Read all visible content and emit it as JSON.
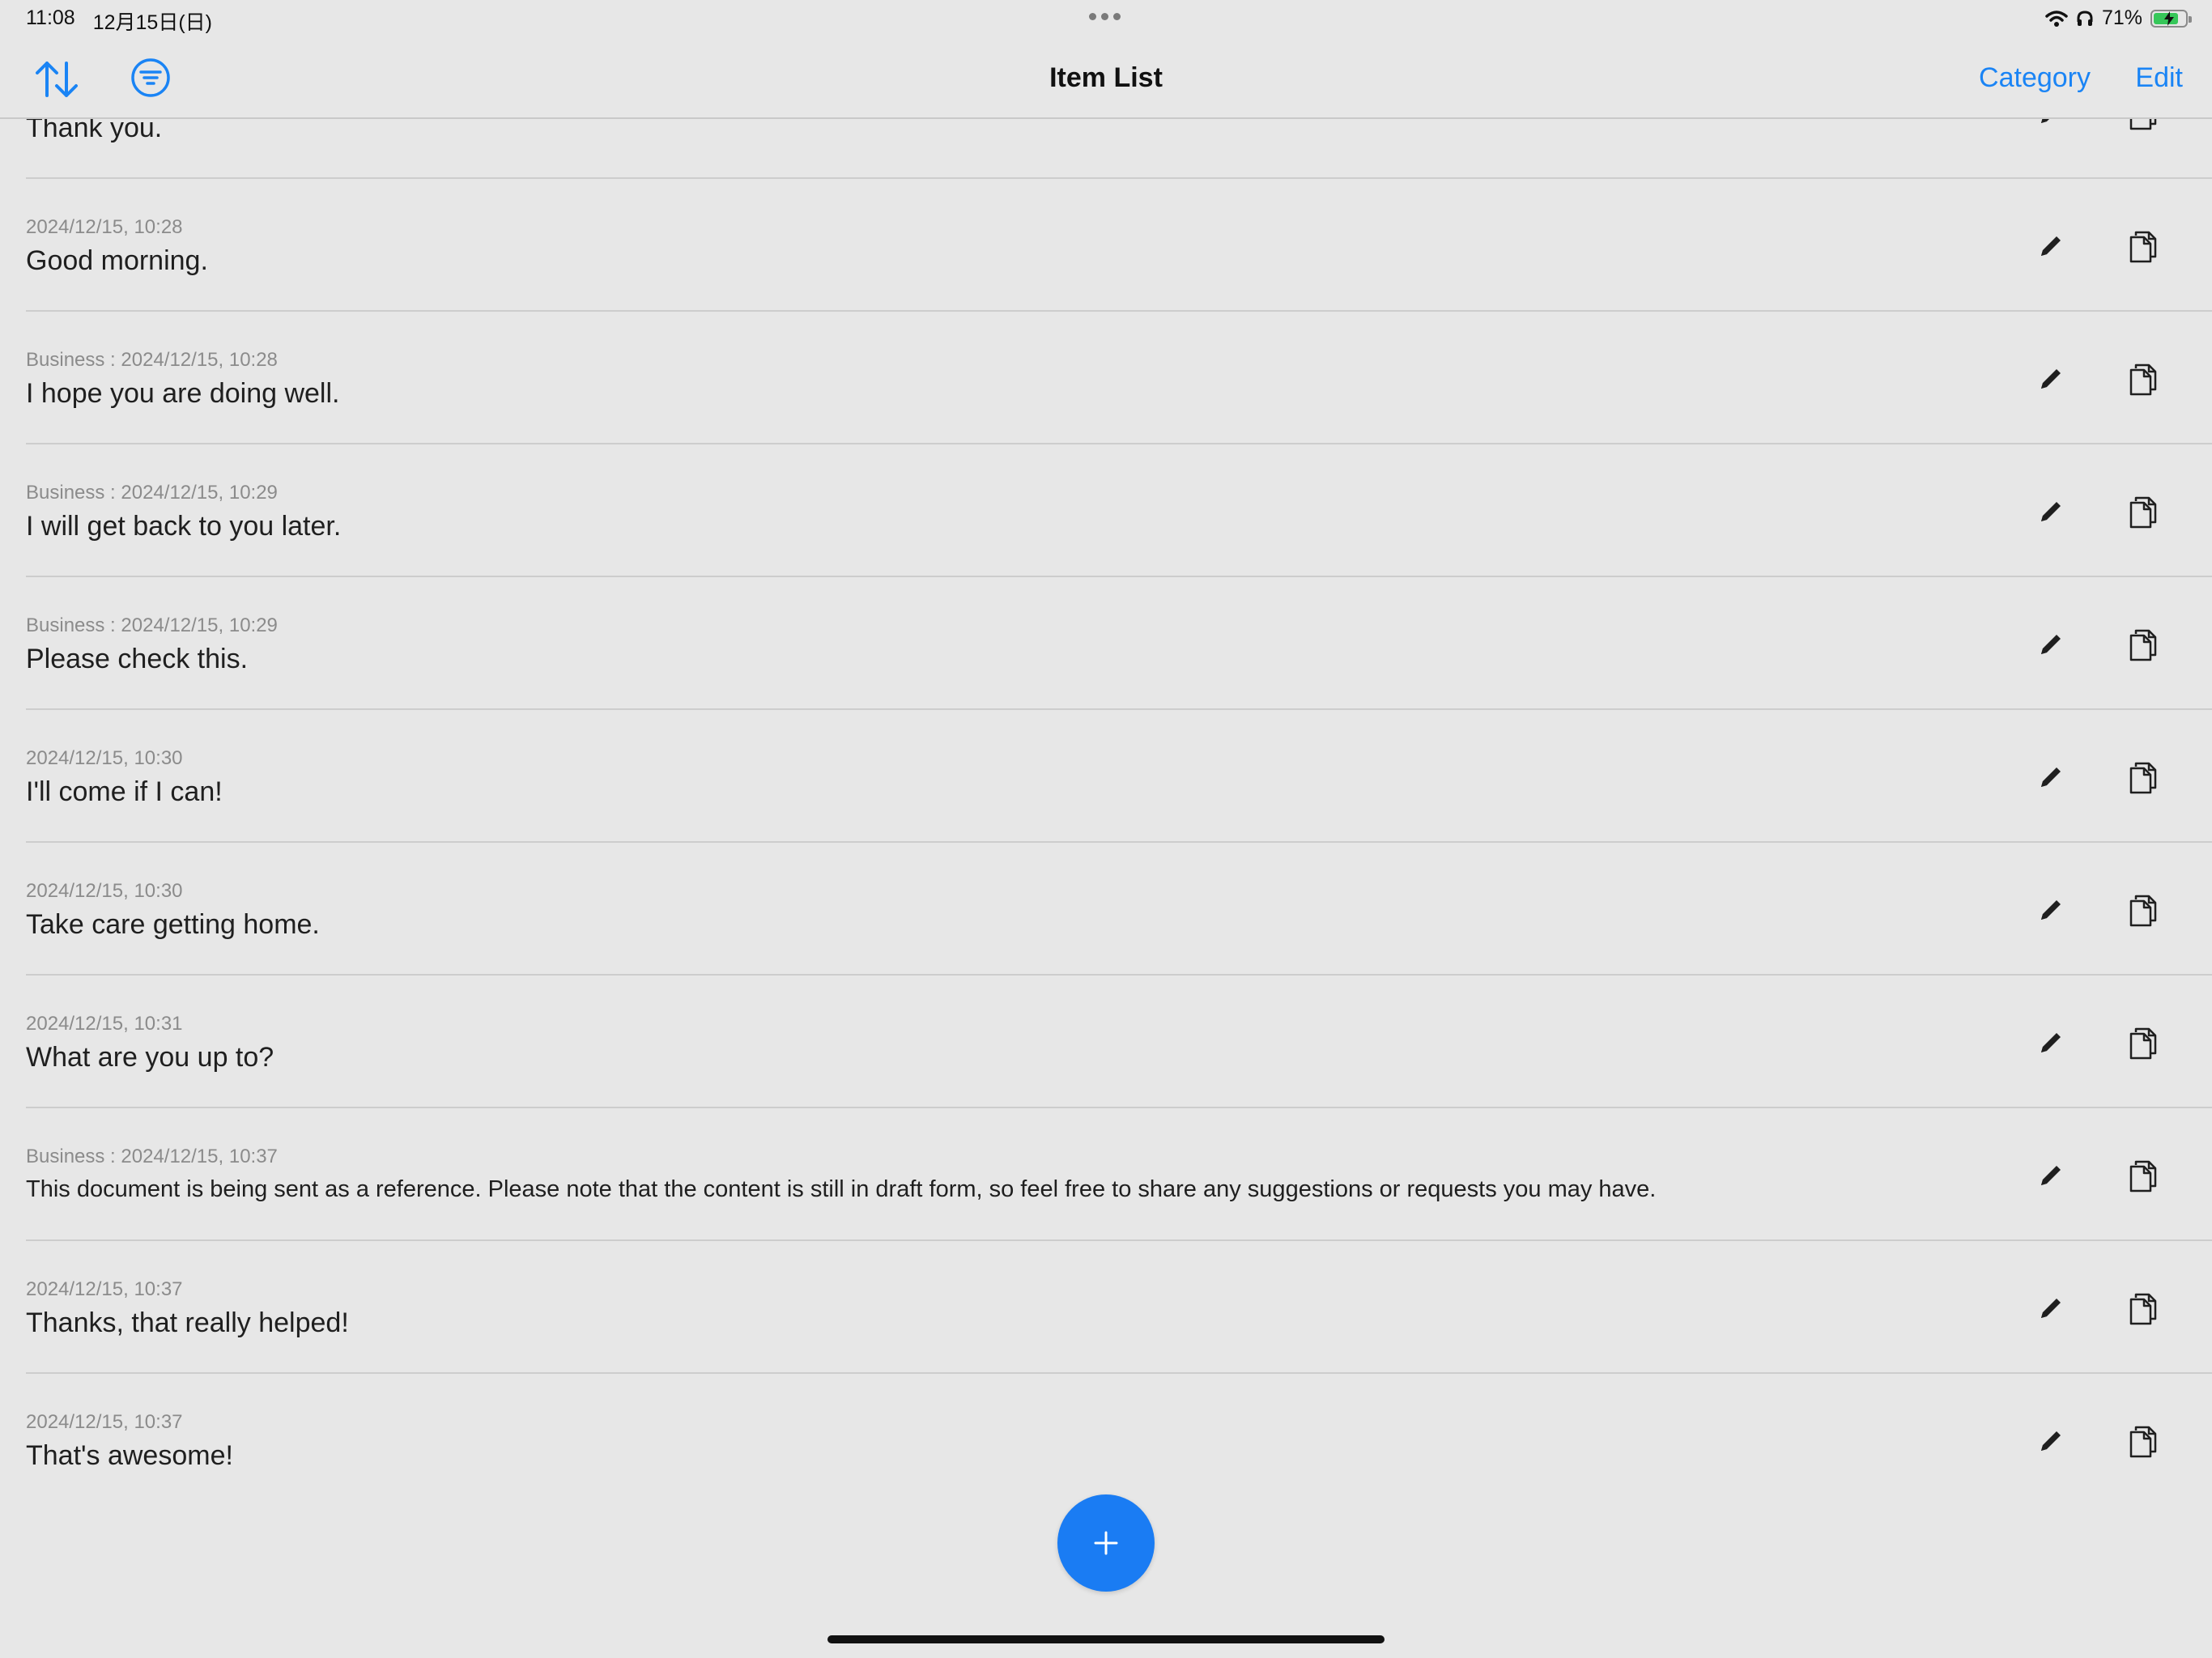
{
  "status_bar": {
    "time": "11:08",
    "date": "12月15日(日)",
    "battery_percent": "71%",
    "battery_level": 0.71,
    "icons": [
      "wifi-icon",
      "headphones-icon",
      "battery-charging-icon"
    ]
  },
  "nav": {
    "title": "Item List",
    "category_label": "Category",
    "edit_label": "Edit",
    "left_icons": [
      "sort-arrows-icon",
      "filter-icon"
    ],
    "accent_color": "#1a84f5"
  },
  "items": [
    {
      "meta": "",
      "text": "Thank you."
    },
    {
      "meta": "2024/12/15, 10:28",
      "text": "Good morning."
    },
    {
      "meta": "Business :  2024/12/15, 10:28",
      "text": "I hope you are doing well."
    },
    {
      "meta": "Business :  2024/12/15, 10:29",
      "text": "I will get back to you later."
    },
    {
      "meta": "Business :  2024/12/15, 10:29",
      "text": "Please check this."
    },
    {
      "meta": "2024/12/15, 10:30",
      "text": "I'll come if I can!"
    },
    {
      "meta": "2024/12/15, 10:30",
      "text": "Take care getting home."
    },
    {
      "meta": "2024/12/15, 10:31",
      "text": "What are you up to?"
    },
    {
      "meta": "Business :  2024/12/15, 10:37",
      "text": "This document is being sent as a reference. Please note that the content is still in draft form, so feel free to share any suggestions or requests you may have."
    },
    {
      "meta": "2024/12/15, 10:37",
      "text": "Thanks, that really helped!"
    },
    {
      "meta": "2024/12/15, 10:37",
      "text": "That's awesome!"
    }
  ],
  "row_icons": [
    "pencil-icon",
    "copy-icon"
  ],
  "fab": {
    "icon": "plus-icon",
    "color": "#1a7cf3"
  }
}
